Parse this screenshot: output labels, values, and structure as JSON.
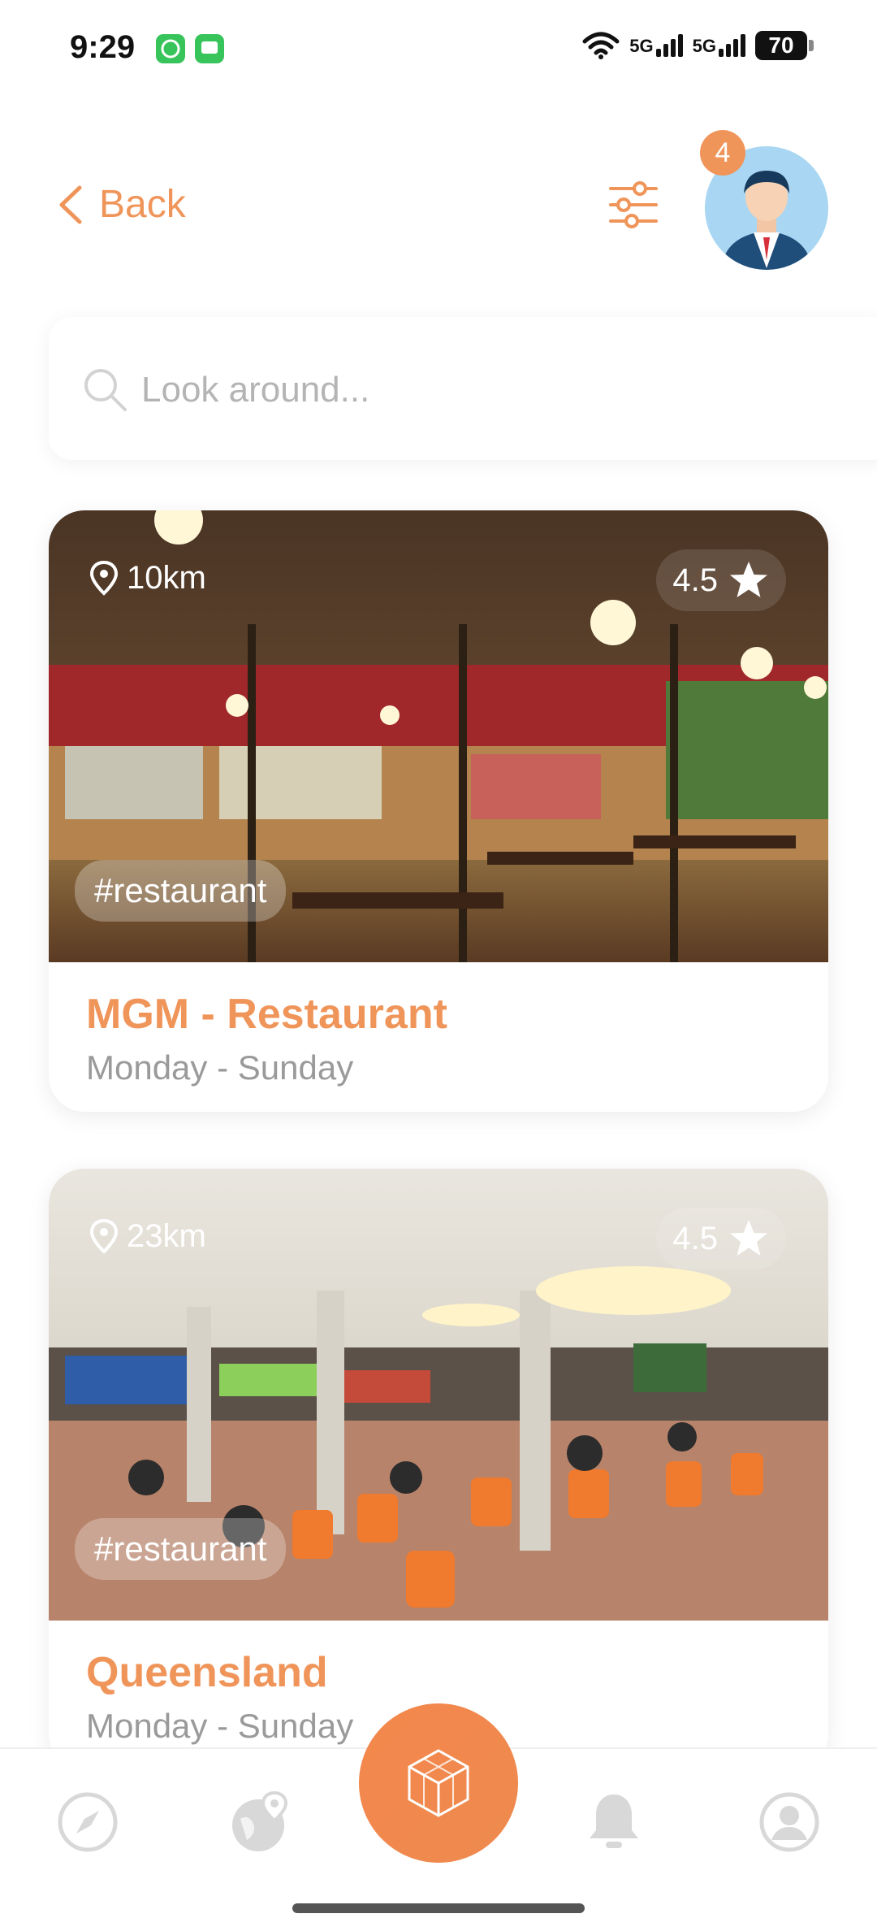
{
  "status_bar": {
    "time": "9:29",
    "network": "5G",
    "battery": "70"
  },
  "header": {
    "back_label": "Back",
    "notification_count": "4"
  },
  "search": {
    "placeholder": "Look around...",
    "value": ""
  },
  "places": [
    {
      "distance": "10km",
      "rating": "4.5",
      "tag": "#restaurant",
      "name": "MGM - Restaurant",
      "days": "Monday - Sunday"
    },
    {
      "distance": "23km",
      "rating": "4.5",
      "tag": "#restaurant",
      "name": "Queensland",
      "days": "Monday - Sunday"
    }
  ],
  "nav": {
    "items": [
      "compass-icon",
      "globe-location-icon",
      "ar-cube-icon",
      "bell-icon",
      "profile-icon"
    ]
  },
  "colors": {
    "accent": "#f0955a",
    "caret": "#6bc1c9"
  }
}
